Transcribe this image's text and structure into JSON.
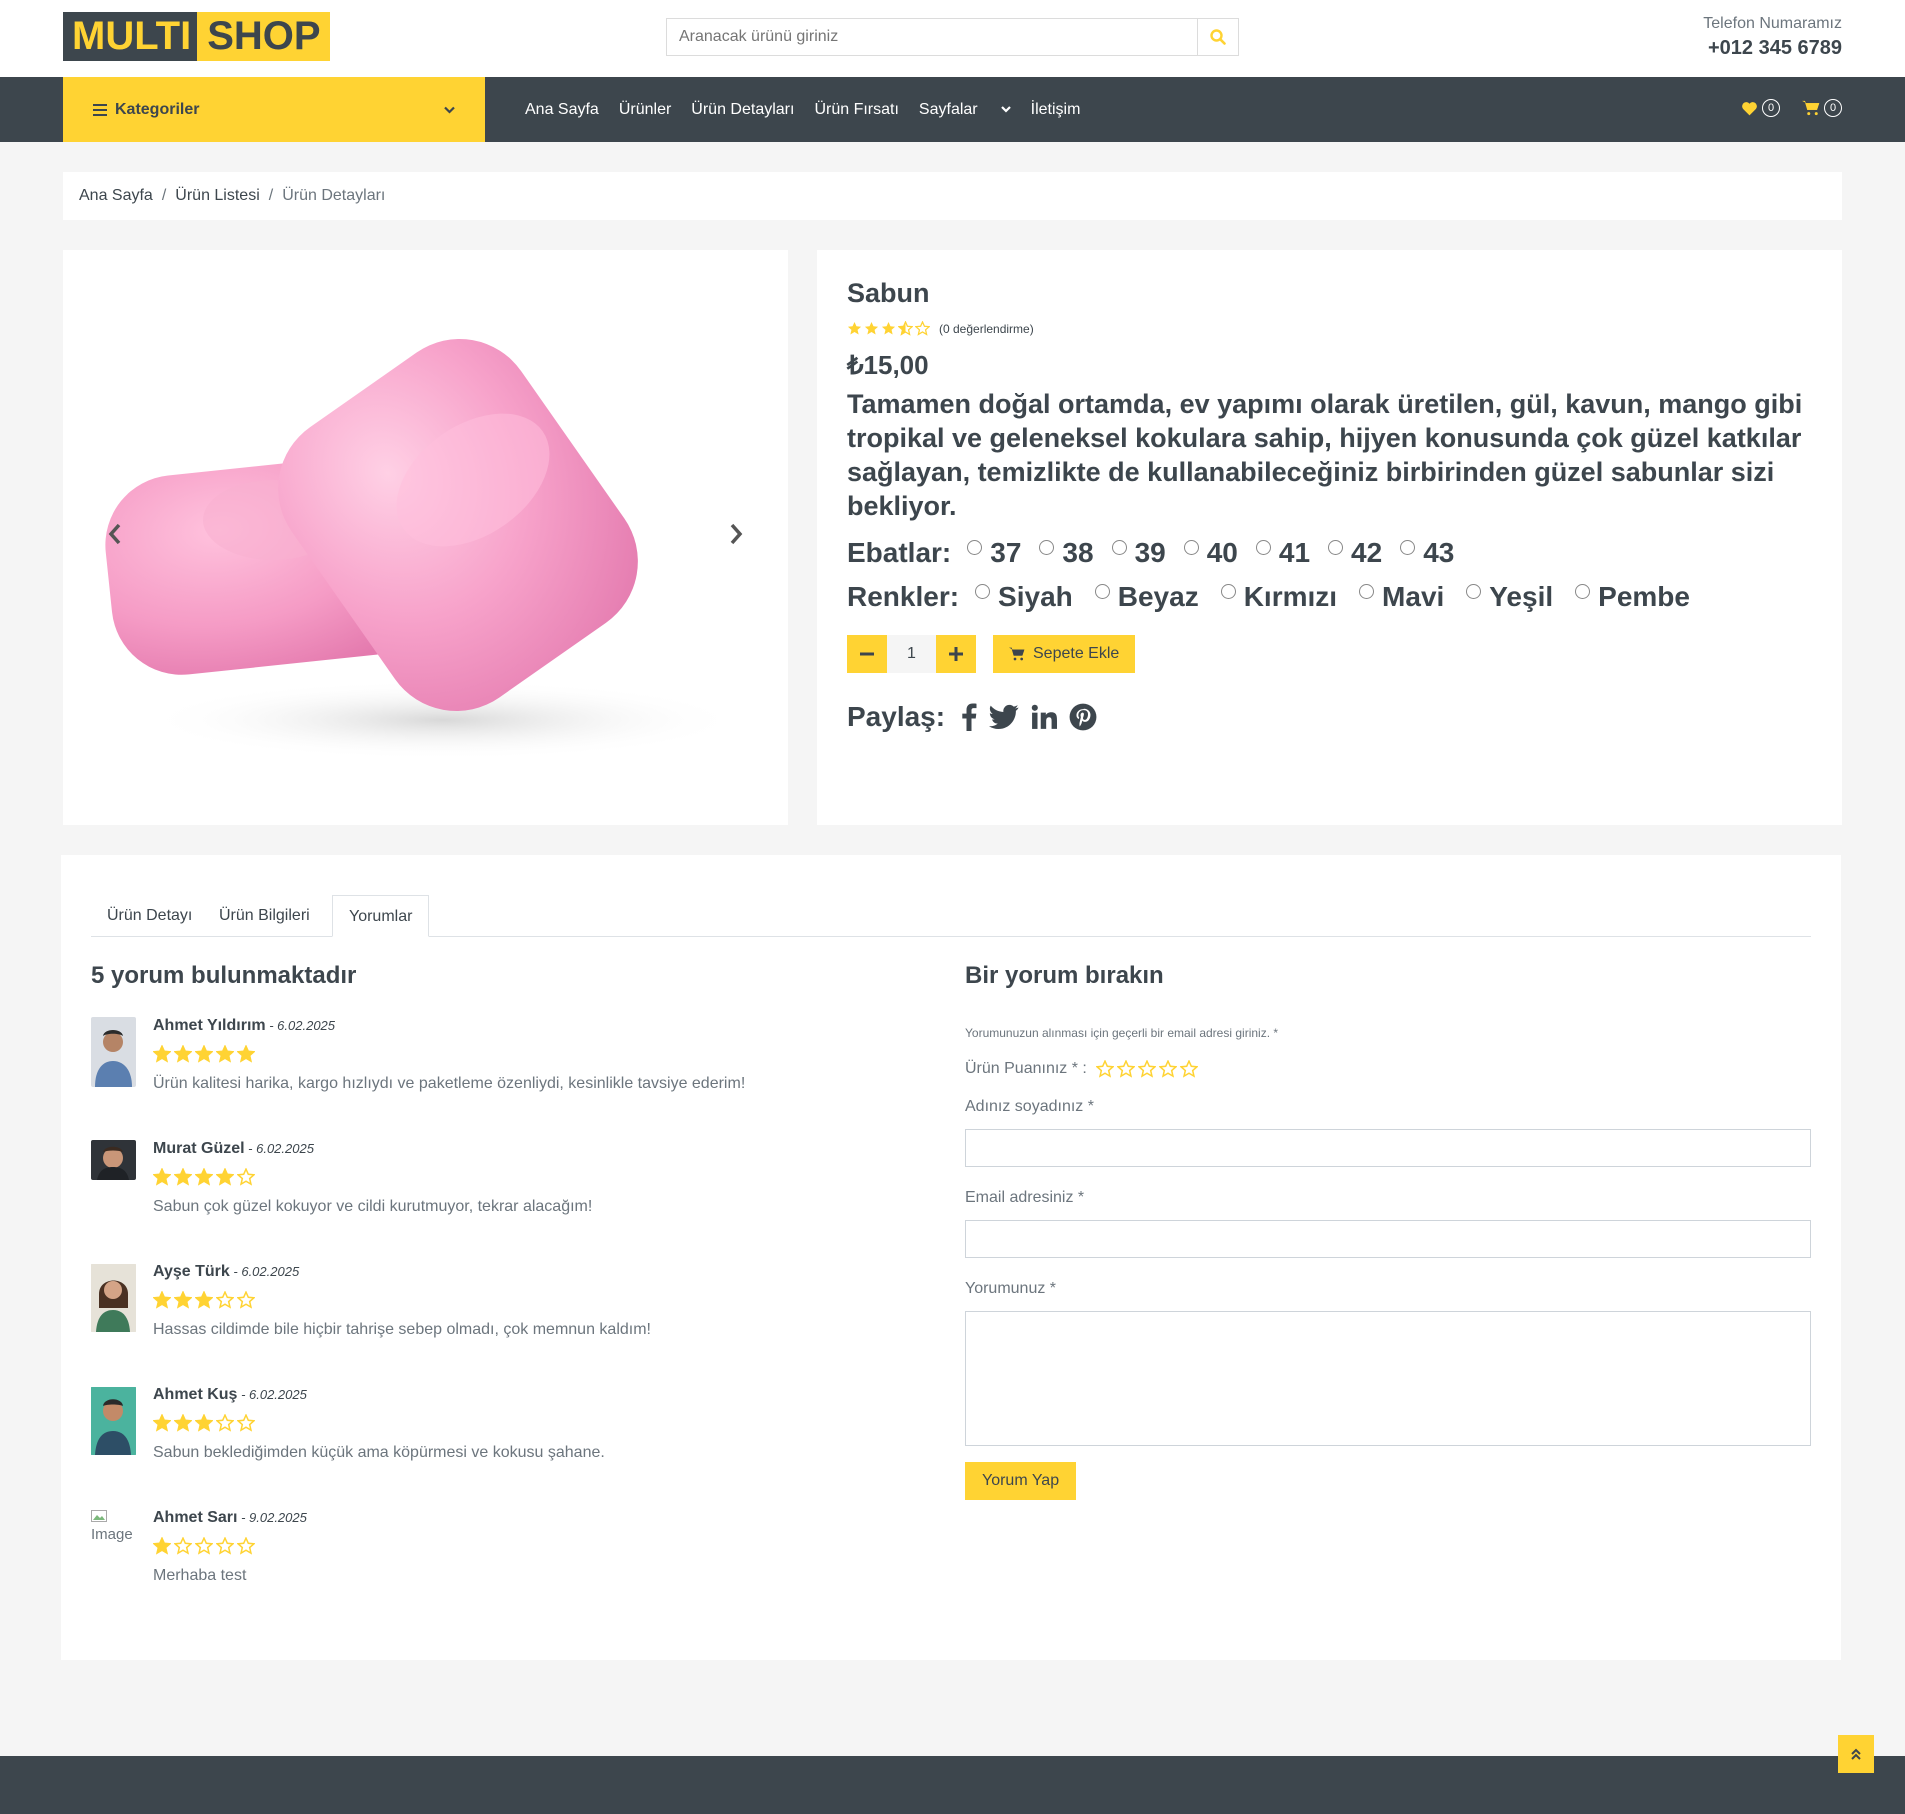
{
  "header": {
    "logo_part1": "MULTI",
    "logo_part2": "SHOP",
    "search_placeholder": "Aranacak ürünü giriniz",
    "phone_label": "Telefon Numaramız",
    "phone_number": "+012 345 6789"
  },
  "nav": {
    "categories_label": "Kategoriler",
    "items": [
      "Ana Sayfa",
      "Ürünler",
      "Ürün Detayları",
      "Ürün Fırsatı",
      "Sayfalar",
      "İletişim"
    ],
    "wishlist_count": "0",
    "cart_count": "0"
  },
  "breadcrumb": {
    "items": [
      "Ana Sayfa",
      "Ürün Listesi",
      "Ürün Detayları"
    ]
  },
  "product": {
    "name": "Sabun",
    "rating": 3.5,
    "rating_count_text": "(0 değerlendirme)",
    "price": "₺15,00",
    "description": "Tamamen doğal ortamda, ev yapımı olarak üretilen, gül, kavun, mango gibi tropikal ve geleneksel kokulara sahip, hijyen konusunda çok güzel katkılar sağlayan, temizlikte de kullanabileceğiniz birbirinden güzel sabunlar sizi bekliyor.",
    "sizes_label": "Ebatlar:",
    "sizes": [
      "37",
      "38",
      "39",
      "40",
      "41",
      "42",
      "43"
    ],
    "colors_label": "Renkler:",
    "colors": [
      "Siyah",
      "Beyaz",
      "Kırmızı",
      "Mavi",
      "Yeşil",
      "Pembe"
    ],
    "quantity": "1",
    "add_to_cart": "Sepete Ekle",
    "share_label": "Paylaş:",
    "accent_color": "#ffd333",
    "soap_color": "#f49bc4"
  },
  "tabs": {
    "items": [
      "Ürün Detayı",
      "Ürün Bilgileri",
      "Yorumlar"
    ],
    "active": "Yorumlar"
  },
  "reviews": {
    "heading": "5 yorum bulunmaktadır",
    "items": [
      {
        "name": "Ahmet Yıldırım",
        "date": " - 6.02.2025",
        "rating": 5,
        "text": "Ürün kalitesi harika, kargo hızlıydı ve paketleme özenliydi, kesinlikle tavsiye ederim!"
      },
      {
        "name": "Murat Güzel",
        "date": " - 6.02.2025",
        "rating": 4,
        "text": "Sabun çok güzel kokuyor ve cildi kurutmuyor, tekrar alacağım!"
      },
      {
        "name": "Ayşe Türk",
        "date": " - 6.02.2025",
        "rating": 3,
        "text": "Hassas cildimde bile hiçbir tahrişe sebep olmadı, çok memnun kaldım!"
      },
      {
        "name": "Ahmet Kuş",
        "date": " - 6.02.2025",
        "rating": 3,
        "text": "Sabun beklediğimden küçük ama köpürmesi ve kokusu şahane."
      },
      {
        "name": "Ahmet Sarı",
        "date": " - 9.02.2025",
        "rating": 1,
        "text": "Merhaba test",
        "avatar_alt": "Image"
      }
    ]
  },
  "review_form": {
    "heading": "Bir yorum bırakın",
    "note": "Yorumunuzun alınması için geçerli bir email adresi giriniz. *",
    "rating_label": "Ürün Puanınız * :",
    "name_label": "Adınız soyadınız *",
    "email_label": "Email adresiniz *",
    "comment_label": "Yorumunuz *",
    "submit": "Yorum Yap"
  }
}
